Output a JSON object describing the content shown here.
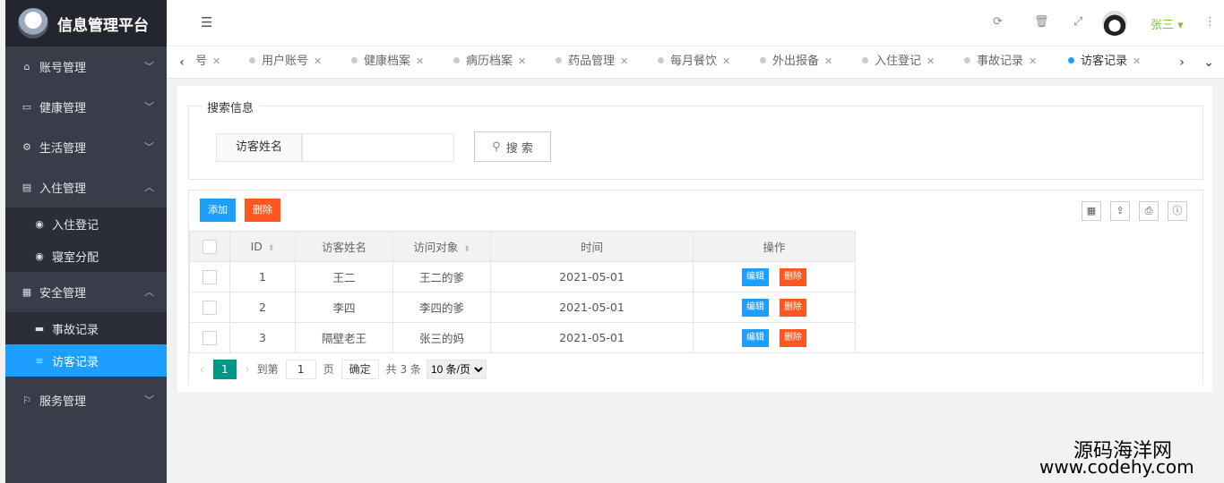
{
  "app": {
    "title": "信息管理平台"
  },
  "user": {
    "name": "张三"
  },
  "sidebar": {
    "items": [
      {
        "label": "账号管理",
        "icon": "home-icon"
      },
      {
        "label": "健康管理",
        "icon": "window-icon"
      },
      {
        "label": "生活管理",
        "icon": "gears-icon"
      },
      {
        "label": "入住管理",
        "icon": "file-icon"
      },
      {
        "label": "入住登记",
        "icon": "dashboard-icon"
      },
      {
        "label": "寝室分配",
        "icon": "dashboard-icon"
      },
      {
        "label": "安全管理",
        "icon": "calendar-icon"
      },
      {
        "label": "事故记录",
        "icon": "list-icon"
      },
      {
        "label": "访客记录",
        "icon": "list-icon"
      },
      {
        "label": "服务管理",
        "icon": "flag-icon"
      }
    ]
  },
  "tabs": [
    "号",
    "用户账号",
    "健康档案",
    "病历档案",
    "药品管理",
    "每月餐饮",
    "外出报备",
    "入住登记",
    "事故记录",
    "访客记录"
  ],
  "search": {
    "legend": "搜索信息",
    "field_label": "访客姓名",
    "field_value": "",
    "button": "搜 索"
  },
  "toolbar": {
    "add": "添加",
    "delete": "删除"
  },
  "table": {
    "headers": [
      "ID",
      "访客姓名",
      "访问对象",
      "时间",
      "操作"
    ],
    "rows": [
      {
        "id": "1",
        "name": "王二",
        "target": "王二的爹",
        "time": "2021-05-01"
      },
      {
        "id": "2",
        "name": "李四",
        "target": "李四的爹",
        "time": "2021-05-01"
      },
      {
        "id": "3",
        "name": "隔壁老王",
        "target": "张三的妈",
        "time": "2021-05-01"
      }
    ],
    "edit": "编辑",
    "del": "删除"
  },
  "pager": {
    "current": "1",
    "goto": "到第",
    "page_input": "1",
    "page_unit": "页",
    "confirm": "确定",
    "total": "共 3 条",
    "size": "10 条/页"
  },
  "watermark": {
    "line1": "源码海洋网",
    "line2": "www.codehy.com"
  }
}
